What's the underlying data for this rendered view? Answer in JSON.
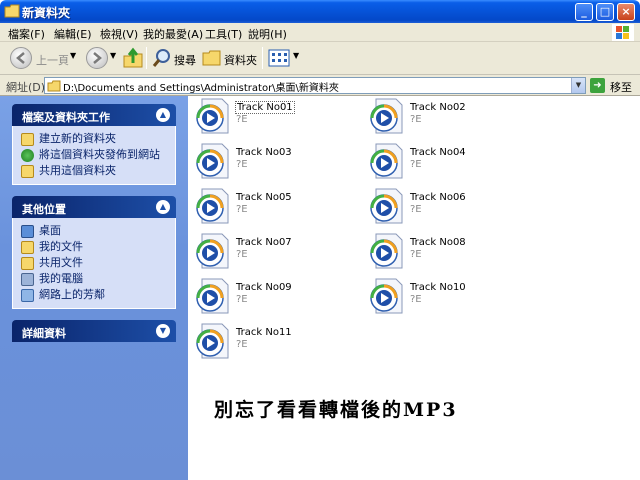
{
  "window": {
    "title": "新資料夾",
    "min_label": "_",
    "max_label": "□",
    "close_label": "×"
  },
  "menu": {
    "items": [
      {
        "label": "檔案(F)"
      },
      {
        "label": "編輯(E)"
      },
      {
        "label": "檢視(V)"
      },
      {
        "label": "我的最愛(A)"
      },
      {
        "label": "工具(T)"
      },
      {
        "label": "說明(H)"
      }
    ]
  },
  "toolbar": {
    "back_label": "上一頁",
    "search_label": "搜尋",
    "folders_label": "資料夾"
  },
  "address": {
    "label": "網址(D)",
    "value": "D:\\Documents and Settings\\Administrator\\桌面\\新資料夾",
    "go_label": "移至"
  },
  "tasks": {
    "file_tasks": {
      "title": "檔案及資料夾工作",
      "items": [
        {
          "label": "建立新的資料夾",
          "icon": "new-folder-icon"
        },
        {
          "label": "將這個資料夾發佈到網站",
          "icon": "publish-web-icon"
        },
        {
          "label": "共用這個資料夾",
          "icon": "share-folder-icon"
        }
      ]
    },
    "other_places": {
      "title": "其他位置",
      "items": [
        {
          "label": "桌面",
          "icon": "desktop-icon"
        },
        {
          "label": "我的文件",
          "icon": "my-documents-icon"
        },
        {
          "label": "共用文件",
          "icon": "shared-documents-icon"
        },
        {
          "label": "我的電腦",
          "icon": "my-computer-icon"
        },
        {
          "label": "網路上的芳鄰",
          "icon": "network-places-icon"
        }
      ]
    },
    "details": {
      "title": "詳細資料"
    }
  },
  "files": [
    {
      "name": "Track No01",
      "sub": "?E"
    },
    {
      "name": "Track No02",
      "sub": "?E"
    },
    {
      "name": "Track No03",
      "sub": "?E"
    },
    {
      "name": "Track No04",
      "sub": "?E"
    },
    {
      "name": "Track No05",
      "sub": "?E"
    },
    {
      "name": "Track No06",
      "sub": "?E"
    },
    {
      "name": "Track No07",
      "sub": "?E"
    },
    {
      "name": "Track No08",
      "sub": "?E"
    },
    {
      "name": "Track No09",
      "sub": "?E"
    },
    {
      "name": "Track No10",
      "sub": "?E"
    },
    {
      "name": "Track No11",
      "sub": "?E"
    }
  ],
  "caption": "別忘了看看轉檔後的MP3",
  "colors": {
    "titlebar": "#0653d8",
    "task_pane": "#6b8fd6",
    "panel_body": "#d6dff7",
    "link_text": "#0a246a"
  }
}
